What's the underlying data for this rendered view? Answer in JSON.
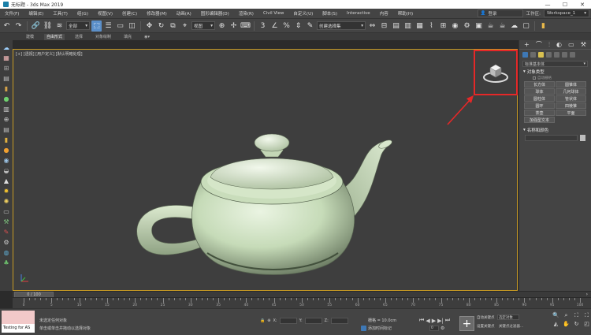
{
  "window": {
    "title": "无标题 - 3ds Max 2019",
    "minimize": "—",
    "maximize": "☐",
    "close": "✕"
  },
  "menubar": {
    "items": [
      "文件(F)",
      "编辑(E)",
      "工具(T)",
      "组(G)",
      "视图(V)",
      "创建(C)",
      "修改器(M)",
      "动画(A)",
      "图形编辑器(D)",
      "渲染(R)",
      "Civil View",
      "自定义(U)",
      "脚本(S)",
      "Interactive",
      "内容",
      "帮助(H)"
    ],
    "user": "登录",
    "workspace_label": "工作区:",
    "workspace_value": "Workspace_1"
  },
  "toolbar": {
    "selection_filter": "全部",
    "view_dropdown": "视图",
    "selection_set": "创建选择集"
  },
  "ribbon": {
    "tabs": [
      "建模",
      "自由形式",
      "选择",
      "对象绘制",
      "填充"
    ]
  },
  "viewport": {
    "label": "[+] [透视] [用户定义] [默认明暗处理]",
    "teapot_color": "#cfe3c2",
    "highlight_color": "#e52828",
    "axis_labels": {
      "x": "x",
      "y": "y",
      "z": "z"
    }
  },
  "command_panel": {
    "category_dropdown": "标准基本体",
    "object_type_title": "对象类型",
    "autogrid_label": "自动栅格",
    "primitives": [
      "长方体",
      "圆锥体",
      "球体",
      "几何球体",
      "圆柱体",
      "管状体",
      "圆环",
      "四棱锥",
      "茶壶",
      "平面",
      "加强型文本"
    ],
    "name_color_title": "名称和颜色"
  },
  "timeline": {
    "slider_label": "0 / 100",
    "ticks": [
      "0",
      "5",
      "10",
      "15",
      "20",
      "25",
      "30",
      "35",
      "40",
      "45",
      "50",
      "55",
      "60",
      "65",
      "70",
      "75",
      "80",
      "85",
      "90",
      "95",
      "100"
    ]
  },
  "statusbar": {
    "script_text": "Testing for AS",
    "status_line1": "未选定任何对象",
    "status_line2": "单击或单击并拖动以选择对象",
    "x_label": "X:",
    "y_label": "Y:",
    "z_label": "Z:",
    "grid_label": "栅格 = 10.0cm",
    "add_time_tag": "添加时间标记",
    "frame_value": "0",
    "auto_key": "自动关键点",
    "auto_key_value": "选定对象",
    "set_key": "设置关键点",
    "key_filters": "关键点过滤器..."
  }
}
